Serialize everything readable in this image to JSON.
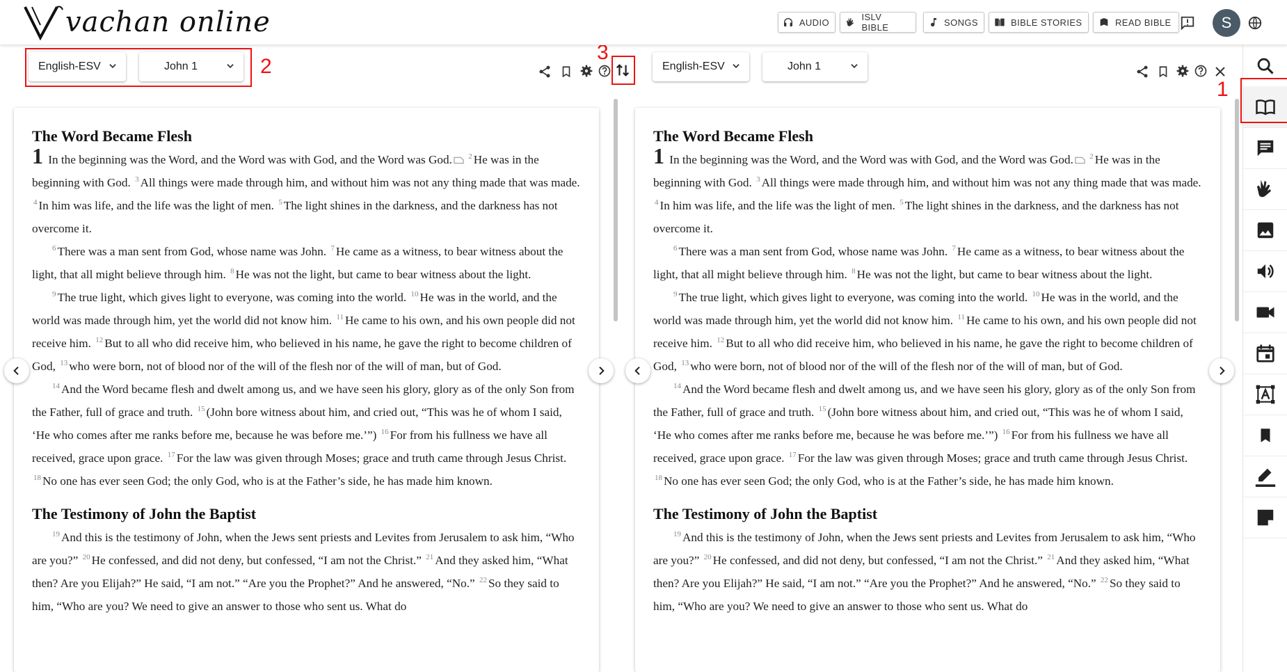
{
  "header": {
    "logo_text": "vachan online",
    "buttons": [
      {
        "label": "AUDIO",
        "icon": "headphones-icon"
      },
      {
        "label": "ISLV BIBLE",
        "icon": "sign-language-icon"
      },
      {
        "label": "SONGS",
        "icon": "music-note-icon"
      },
      {
        "label": "BIBLE STORIES",
        "icon": "book-stories-icon"
      },
      {
        "label": "READ BIBLE",
        "icon": "read-bible-icon"
      }
    ],
    "avatar_letter": "S"
  },
  "annotations": {
    "n1": "1",
    "n2": "2",
    "n3": "3"
  },
  "left_pane": {
    "version": "English-ESV",
    "chapter": "John 1"
  },
  "right_pane": {
    "version": "English-ESV",
    "chapter": "John 1"
  },
  "passage": {
    "heading1": "The Word Became Flesh",
    "chapter_number": "1",
    "v1": "In the beginning was the Word, and the Word was with God, and the Word was God.",
    "v2": "He was in the beginning with God.",
    "v3": "All things were made through him, and without him was not any thing made that was made.",
    "v4": "In him was life, and the life was the light of men.",
    "v5": "The light shines in the darkness, and the darkness has not overcome it.",
    "v6": "There was a man sent from God, whose name was John.",
    "v7": "He came as a witness, to bear witness about the light, that all might believe through him.",
    "v8": "He was not the light, but came to bear witness about the light.",
    "v9": "The true light, which gives light to everyone, was coming into the world.",
    "v10": "He was in the world, and the world was made through him, yet the world did not know him.",
    "v11": "He came to his own, and his own people did not receive him.",
    "v12": "But to all who did receive him, who believed in his name, he gave the right to become children of God,",
    "v13": "who were born, not of blood nor of the will of the flesh nor of the will of man, but of God.",
    "v14": "And the Word became flesh and dwelt among us, and we have seen his glory, glory as of the only Son from the Father, full of grace and truth.",
    "v15": "(John bore witness about him, and cried out, “This was he of whom I said, ‘He who comes after me ranks before me, because he was before me.’”)",
    "v16": "For from his fullness we have all received, grace upon grace.",
    "v17": "For the law was given through Moses; grace and truth came through Jesus Christ.",
    "v18": "No one has ever seen God; the only God, who is at the Father’s side, he has made him known.",
    "heading2": "The Testimony of John the Baptist",
    "v19": "And this is the testimony of John, when the Jews sent priests and Levites from Jerusalem to ask him, “Who are you?”",
    "v20": "He confessed, and did not deny, but confessed, “I am not the Christ.”",
    "v21": "And they asked him, “What then? Are you Elijah?” He said, “I am not.” “Are you the Prophet?” And he answered, “No.”",
    "v22": "So they said to him, “Who are you? We need to give an answer to those who sent us. What do"
  },
  "verse_numbers": {
    "n2": "2",
    "n3": "3",
    "n4": "4",
    "n5": "5",
    "n6": "6",
    "n7": "7",
    "n8": "8",
    "n9": "9",
    "n10": "10",
    "n11": "11",
    "n12": "12",
    "n13": "13",
    "n14": "14",
    "n15": "15",
    "n16": "16",
    "n17": "17",
    "n18": "18",
    "n19": "19",
    "n20": "20",
    "n21": "21",
    "n22": "22"
  },
  "sidebar_icons": [
    "bible-icon",
    "comment-icon",
    "sign-language-icon",
    "image-icon",
    "audio-icon",
    "video-icon",
    "calendar-icon",
    "dictionary-icon",
    "bookmark-icon",
    "highlight-icon",
    "notes-icon"
  ]
}
